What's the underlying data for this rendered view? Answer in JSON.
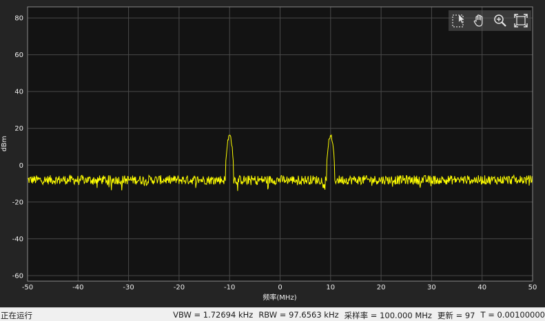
{
  "status": {
    "state": "正在运行",
    "vbw": "VBW = 1.72694 kHz",
    "rbw": "RBW = 97.6563 kHz",
    "sample_rate": "采样率 = 100.000 MHz",
    "update": "更新 = 97",
    "time": "T = 0.00100000"
  },
  "toolbar": {
    "icons": [
      "cursor-icon",
      "pan-hand-icon",
      "zoom-in-icon",
      "fit-view-icon"
    ]
  },
  "colors": {
    "background": "#242424",
    "plot_area": "#131313",
    "grid": "#4a4a4a",
    "trace": "#ffff00"
  },
  "chart_data": {
    "type": "line",
    "xlabel": "频率(MHz)",
    "ylabel": "dBm",
    "xlim": [
      -50,
      50
    ],
    "ylim": [
      -63,
      86
    ],
    "xticks": [
      -50,
      -40,
      -30,
      -20,
      -10,
      0,
      10,
      20,
      30,
      40,
      50
    ],
    "yticks": [
      -60,
      -40,
      -20,
      0,
      20,
      40,
      60,
      80
    ],
    "grid": true,
    "series": [
      {
        "noise_floor_dbm": -8,
        "peaks": [
          {
            "x": -10,
            "y": 16
          },
          {
            "x": 10,
            "y": 16
          }
        ]
      }
    ]
  }
}
